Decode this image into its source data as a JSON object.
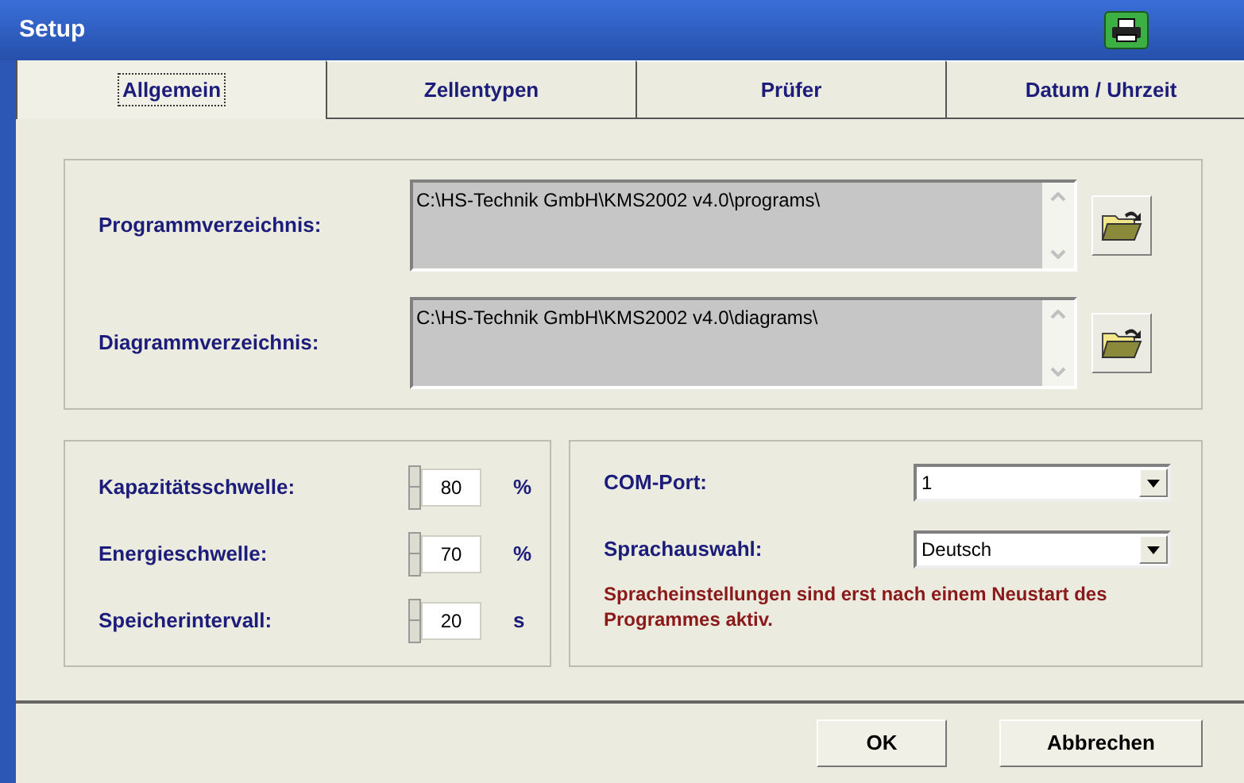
{
  "window": {
    "title": "Setup"
  },
  "tabs": [
    {
      "label": "Allgemein",
      "selected": true
    },
    {
      "label": "Zellentypen",
      "selected": false
    },
    {
      "label": "Prüfer",
      "selected": false
    },
    {
      "label": "Datum / Uhrzeit",
      "selected": false
    }
  ],
  "directories": [
    {
      "label": "Programmverzeichnis:",
      "value": "C:\\HS-Technik GmbH\\KMS2002 v4.0\\programs\\"
    },
    {
      "label": "Diagrammverzeichnis:",
      "value": "C:\\HS-Technik GmbH\\KMS2002 v4.0\\diagrams\\"
    }
  ],
  "spinners": [
    {
      "label": "Kapazitätsschwelle:",
      "value": "80",
      "unit": "%"
    },
    {
      "label": "Energieschwelle:",
      "value": "70",
      "unit": "%"
    },
    {
      "label": "Speicherintervall:",
      "value": "20",
      "unit": "s"
    }
  ],
  "selects": [
    {
      "label": "COM-Port:",
      "value": "1"
    },
    {
      "label": "Sprachauswahl:",
      "value": "Deutsch"
    }
  ],
  "notice": "Spracheinstellungen sind erst nach einem Neustart des Programmes aktiv.",
  "buttons": [
    "OK",
    "Abbrechen"
  ]
}
